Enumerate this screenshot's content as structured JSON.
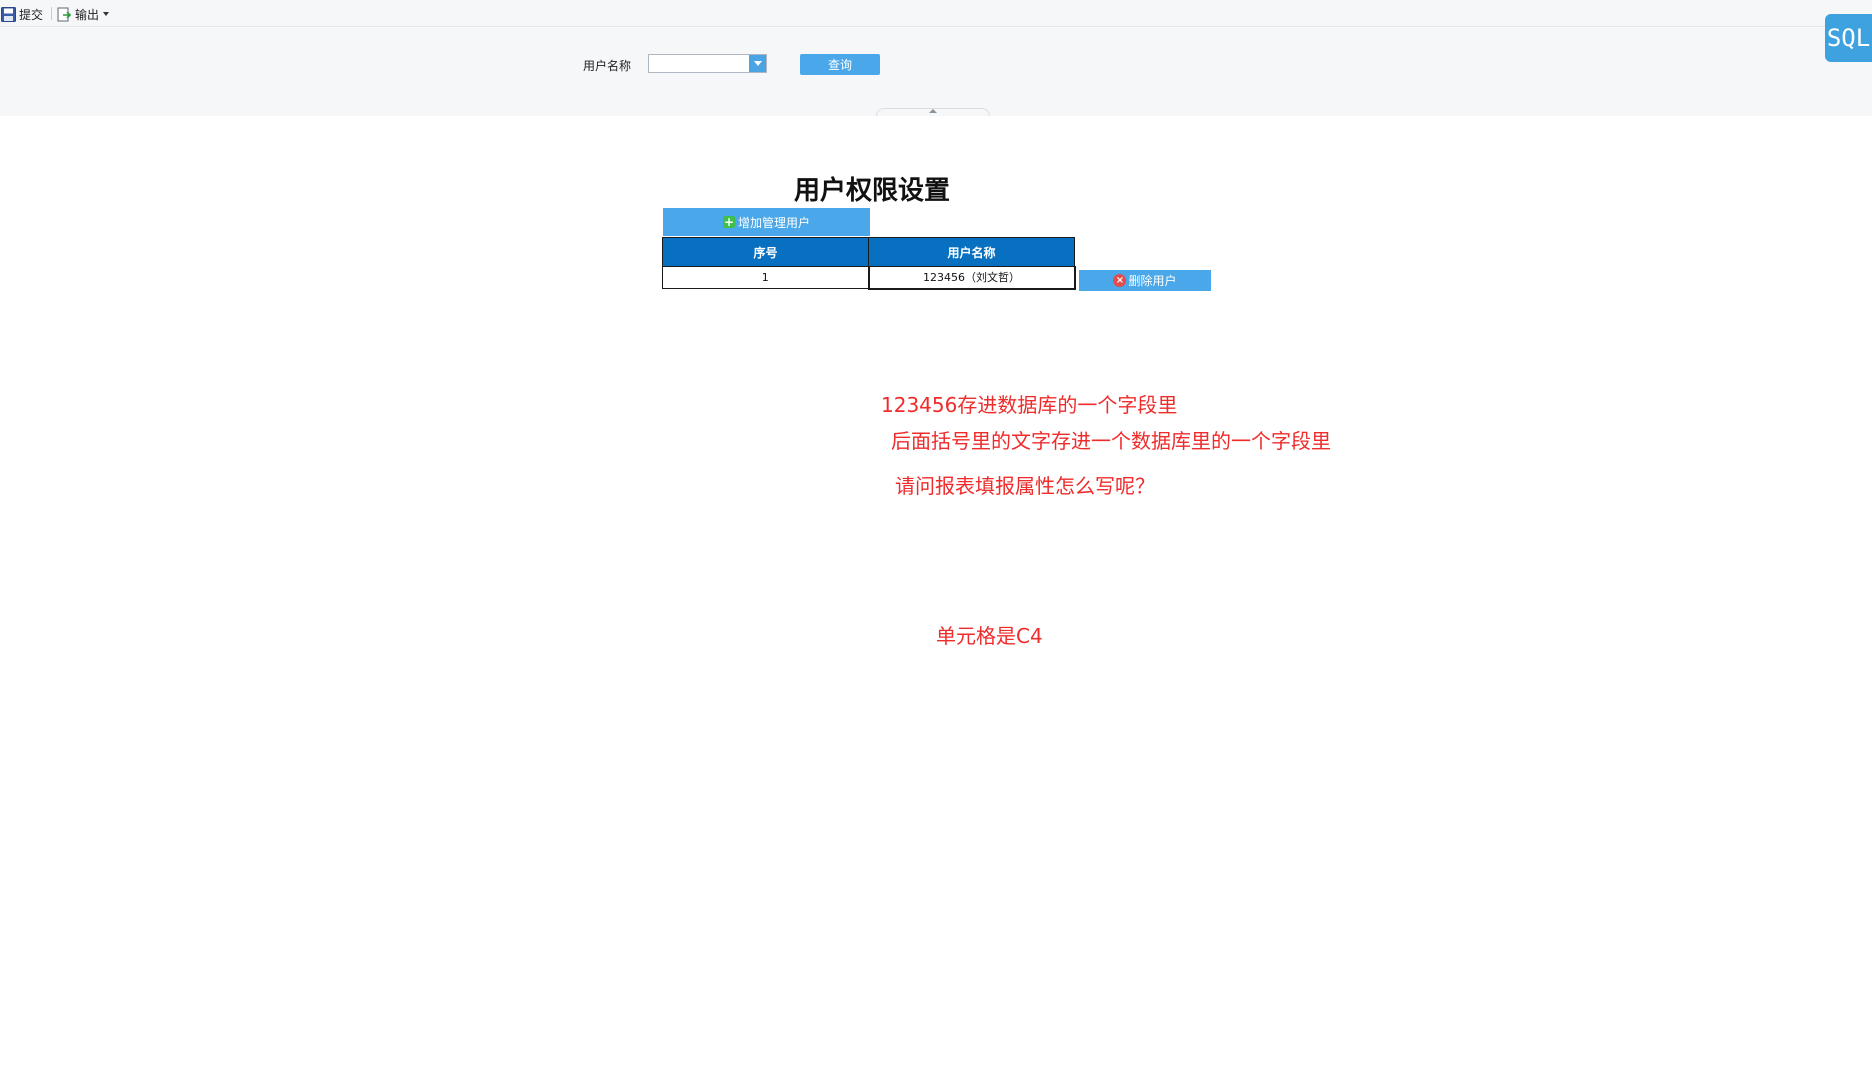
{
  "toolbar": {
    "submit_label": "提交",
    "export_label": "输出"
  },
  "params": {
    "user_name_label": "用户名称",
    "user_name_value": "",
    "query_label": "查询"
  },
  "sql_badge": "SQL",
  "report": {
    "title": "用户权限设置",
    "add_button": "增加管理用户",
    "columns": [
      "序号",
      "用户名称"
    ],
    "rows": [
      {
        "index": "1",
        "name": "123456（刘文哲）"
      }
    ],
    "delete_button": "删除用户"
  },
  "annotations": {
    "line1": "123456存进数据库的一个字段里",
    "line2": "后面括号里的文字存进一个数据库里的一个字段里",
    "line3": "请问报表填报属性怎么写呢？",
    "line4": "单元格是C4"
  },
  "colors": {
    "accent_blue": "#4aa8ea",
    "header_blue": "#0870c1",
    "annotation_red": "#ef2b2b"
  }
}
